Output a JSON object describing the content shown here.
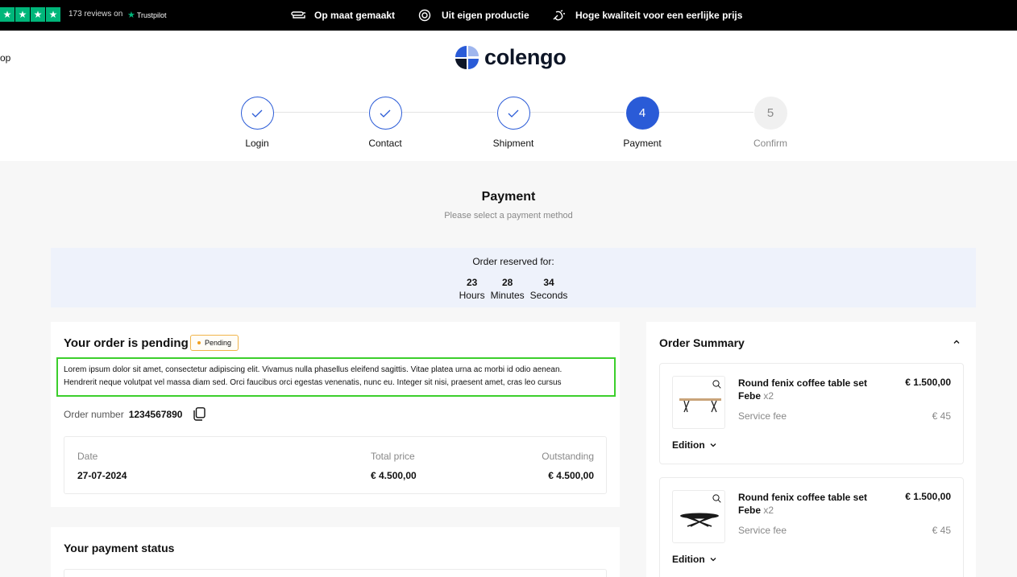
{
  "topbar": {
    "reviews_text": "173 reviews on",
    "trustpilot": "Trustpilot",
    "usps": [
      {
        "icon": "ruler-icon",
        "label": "Op maat gemaakt"
      },
      {
        "icon": "target-icon",
        "label": "Uit eigen productie"
      },
      {
        "icon": "quality-icon",
        "label": "Hoge kwaliteit voor een eerlijke prijs"
      }
    ]
  },
  "header": {
    "cut_left_text": "op",
    "logo_text": "colengo"
  },
  "stepper": {
    "steps": [
      {
        "label": "Login",
        "state": "done",
        "number": ""
      },
      {
        "label": "Contact",
        "state": "done",
        "number": ""
      },
      {
        "label": "Shipment",
        "state": "done",
        "number": ""
      },
      {
        "label": "Payment",
        "state": "active",
        "number": "4"
      },
      {
        "label": "Confirm",
        "state": "todo",
        "number": "5"
      }
    ]
  },
  "page": {
    "title": "Payment",
    "subtitle": "Please select a payment method"
  },
  "timer": {
    "title": "Order reserved for:",
    "cells": [
      {
        "value": "23",
        "unit": "Hours"
      },
      {
        "value": "28",
        "unit": "Minutes"
      },
      {
        "value": "34",
        "unit": "Seconds"
      }
    ]
  },
  "order": {
    "title": "Your order is pending",
    "badge": "Pending",
    "description_line1": "Lorem ipsum dolor sit amet, consectetur adipiscing elit. Vivamus nulla phasellus eleifend sagittis. Vitae platea urna ac morbi id odio aenean.",
    "description_line2": "Hendrerit neque volutpat vel massa diam sed. Orci faucibus orci egestas venenatis, nunc eu. Integer sit nisi, praesent amet, cras leo cursus",
    "order_number_label": "Order number",
    "order_number": "1234567890",
    "table": {
      "date_label": "Date",
      "date_value": "27-07-2024",
      "total_label": "Total price",
      "total_value": "€ 4.500,00",
      "outstanding_label": "Outstanding",
      "outstanding_value": "€ 4.500,00"
    }
  },
  "payment_status": {
    "title": "Your payment status"
  },
  "summary": {
    "title": "Order Summary",
    "items": [
      {
        "name": "Round fenix coffee table set Febe",
        "qty": "x2",
        "price": "€ 1.500,00",
        "fee_label": "Service fee",
        "fee": "€ 45",
        "edition_label": "Edition"
      },
      {
        "name": "Round fenix coffee table set Febe",
        "qty": "x2",
        "price": "€ 1.500,00",
        "fee_label": "Service fee",
        "fee": "€ 45",
        "edition_label": "Edition"
      }
    ]
  },
  "colors": {
    "accent": "#2a5bd7",
    "trustpilot_green": "#00b67a",
    "highlight": "#3ccf2c",
    "pending_border": "#f0b44a",
    "timer_bg": "#eef2fb"
  }
}
